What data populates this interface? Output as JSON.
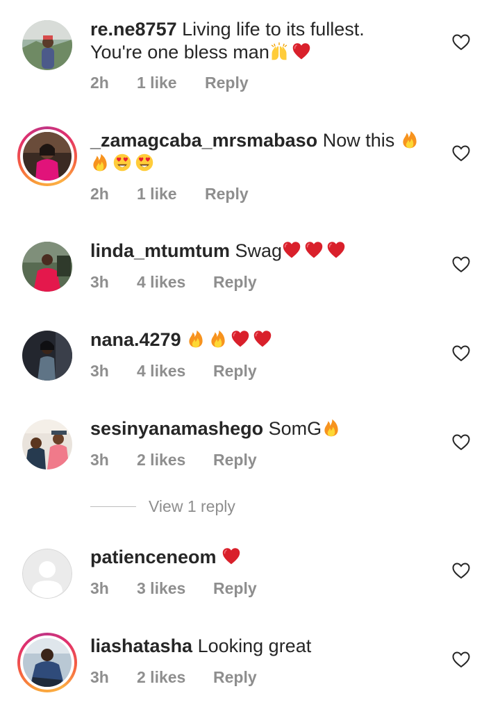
{
  "comments": [
    {
      "username": "re.ne8757",
      "text_line1": "Living life to its fullest.",
      "text_line2": "You're one bless man",
      "time": "2h",
      "likes": "1 like",
      "reply_label": "Reply",
      "emojis": [
        "raised-hands-emoji",
        "red-heart-emoji"
      ]
    },
    {
      "username": "_zamagcaba_mrsmabaso",
      "text_line1": "Now this",
      "time": "2h",
      "likes": "1 like",
      "reply_label": "Reply",
      "emojis": [
        "fire-emoji",
        "fire-emoji",
        "heart-eyes-emoji",
        "heart-eyes-emoji"
      ]
    },
    {
      "username": "linda_mtumtum",
      "text_line1": "Swag",
      "time": "3h",
      "likes": "4 likes",
      "reply_label": "Reply",
      "emojis": [
        "red-heart-emoji",
        "red-heart-emoji",
        "red-heart-emoji"
      ]
    },
    {
      "username": "nana.4279",
      "text_line1": "",
      "time": "3h",
      "likes": "4 likes",
      "reply_label": "Reply",
      "emojis": [
        "fire-emoji",
        "fire-emoji",
        "red-heart-emoji",
        "red-heart-emoji"
      ]
    },
    {
      "username": "sesinyanamashego",
      "text_line1": "SomG",
      "time": "3h",
      "likes": "2 likes",
      "reply_label": "Reply",
      "emojis": [
        "fire-emoji"
      ]
    },
    {
      "username": "patienceneom",
      "text_line1": "",
      "time": "3h",
      "likes": "3 likes",
      "reply_label": "Reply",
      "emojis": [
        "red-heart-emoji"
      ]
    },
    {
      "username": "liashatasha",
      "text_line1": "Looking great",
      "time": "3h",
      "likes": "2 likes",
      "reply_label": "Reply",
      "emojis": []
    }
  ],
  "view_replies_label": "View 1 reply",
  "colors": {
    "text": "#262626",
    "meta": "#8e8e8e",
    "emoji_heart": "#d9202b",
    "emoji_fire": "#f7931e",
    "story_ring_start": "#f9a13a",
    "story_ring_end": "#c13584"
  },
  "icons": {
    "like": "heart-outline-icon"
  }
}
